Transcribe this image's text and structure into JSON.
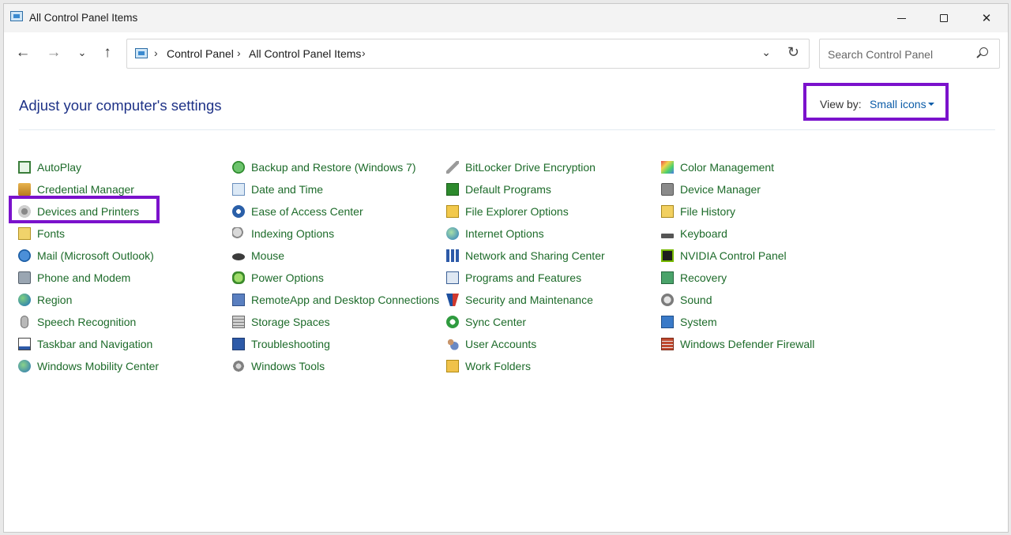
{
  "window": {
    "title": "All Control Panel Items",
    "minimize_label": "Minimize",
    "maximize_label": "Maximize",
    "close_label": "Close"
  },
  "nav": {
    "back_glyph": "←",
    "forward_glyph": "→",
    "recent_glyph": "⌄",
    "up_glyph": "↑"
  },
  "address": {
    "separator": "›",
    "crumbs": [
      "Control Panel",
      "All Control Panel Items"
    ],
    "dropdown_glyph": "⌄",
    "refresh_glyph": "↻"
  },
  "search": {
    "placeholder": "Search Control Panel",
    "value": ""
  },
  "main": {
    "heading": "Adjust your computer's settings",
    "view_by_label": "View by:",
    "view_by_value": "Small icons"
  },
  "colors": {
    "accent_highlight": "#7b12cc",
    "item_text": "#1d6b2a",
    "heading": "#1e3287",
    "link": "#0b5ca8"
  },
  "columns": [
    {
      "items": [
        {
          "label": "AutoPlay",
          "icon": "autoplay-icon"
        },
        {
          "label": "Credential Manager",
          "icon": "credential-manager-icon"
        },
        {
          "label": "Devices and Printers",
          "icon": "devices-printers-icon",
          "highlighted": true
        },
        {
          "label": "Fonts",
          "icon": "fonts-icon"
        },
        {
          "label": "Mail (Microsoft Outlook)",
          "icon": "mail-icon"
        },
        {
          "label": "Phone and Modem",
          "icon": "phone-modem-icon"
        },
        {
          "label": "Region",
          "icon": "region-icon"
        },
        {
          "label": "Speech Recognition",
          "icon": "microphone-icon"
        },
        {
          "label": "Taskbar and Navigation",
          "icon": "taskbar-icon"
        },
        {
          "label": "Windows Mobility Center",
          "icon": "mobility-center-icon"
        }
      ]
    },
    {
      "items": [
        {
          "label": "Backup and Restore (Windows 7)",
          "icon": "backup-restore-icon"
        },
        {
          "label": "Date and Time",
          "icon": "date-time-icon"
        },
        {
          "label": "Ease of Access Center",
          "icon": "ease-of-access-icon"
        },
        {
          "label": "Indexing Options",
          "icon": "indexing-icon"
        },
        {
          "label": "Mouse",
          "icon": "mouse-icon"
        },
        {
          "label": "Power Options",
          "icon": "power-icon"
        },
        {
          "label": "RemoteApp and Desktop Connections",
          "icon": "remoteapp-icon"
        },
        {
          "label": "Storage Spaces",
          "icon": "storage-spaces-icon"
        },
        {
          "label": "Troubleshooting",
          "icon": "troubleshooting-icon"
        },
        {
          "label": "Windows Tools",
          "icon": "windows-tools-icon"
        }
      ]
    },
    {
      "items": [
        {
          "label": "BitLocker Drive Encryption",
          "icon": "bitlocker-key-icon"
        },
        {
          "label": "Default Programs",
          "icon": "default-programs-icon"
        },
        {
          "label": "File Explorer Options",
          "icon": "folder-options-icon"
        },
        {
          "label": "Internet Options",
          "icon": "internet-options-icon"
        },
        {
          "label": "Network and Sharing Center",
          "icon": "network-icon"
        },
        {
          "label": "Programs and Features",
          "icon": "programs-features-icon"
        },
        {
          "label": "Security and Maintenance",
          "icon": "security-flag-icon"
        },
        {
          "label": "Sync Center",
          "icon": "sync-icon"
        },
        {
          "label": "User Accounts",
          "icon": "user-accounts-icon"
        },
        {
          "label": "Work Folders",
          "icon": "work-folders-icon"
        }
      ]
    },
    {
      "items": [
        {
          "label": "Color Management",
          "icon": "color-management-icon"
        },
        {
          "label": "Device Manager",
          "icon": "device-manager-icon"
        },
        {
          "label": "File History",
          "icon": "file-history-icon"
        },
        {
          "label": "Keyboard",
          "icon": "keyboard-icon"
        },
        {
          "label": "NVIDIA Control Panel",
          "icon": "nvidia-icon"
        },
        {
          "label": "Recovery",
          "icon": "recovery-icon"
        },
        {
          "label": "Sound",
          "icon": "speaker-icon"
        },
        {
          "label": "System",
          "icon": "system-icon"
        },
        {
          "label": "Windows Defender Firewall",
          "icon": "firewall-icon"
        }
      ]
    }
  ]
}
